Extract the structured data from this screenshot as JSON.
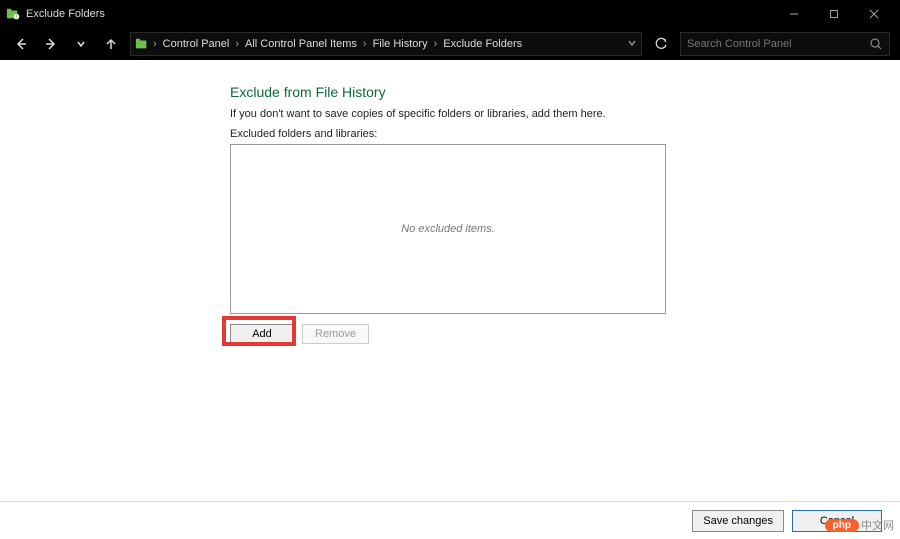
{
  "window": {
    "title": "Exclude Folders"
  },
  "breadcrumb": {
    "items": [
      "Control Panel",
      "All Control Panel Items",
      "File History",
      "Exclude Folders"
    ]
  },
  "search": {
    "placeholder": "Search Control Panel"
  },
  "page": {
    "title": "Exclude from File History",
    "subtitle": "If you don't want to save copies of specific folders or libraries, add them here.",
    "list_label": "Excluded folders and libraries:",
    "empty_text": "No excluded items."
  },
  "buttons": {
    "add": "Add",
    "remove": "Remove",
    "save": "Save changes",
    "cancel": "Cancel"
  },
  "watermark": {
    "brand": "php",
    "rest": "中文网"
  }
}
